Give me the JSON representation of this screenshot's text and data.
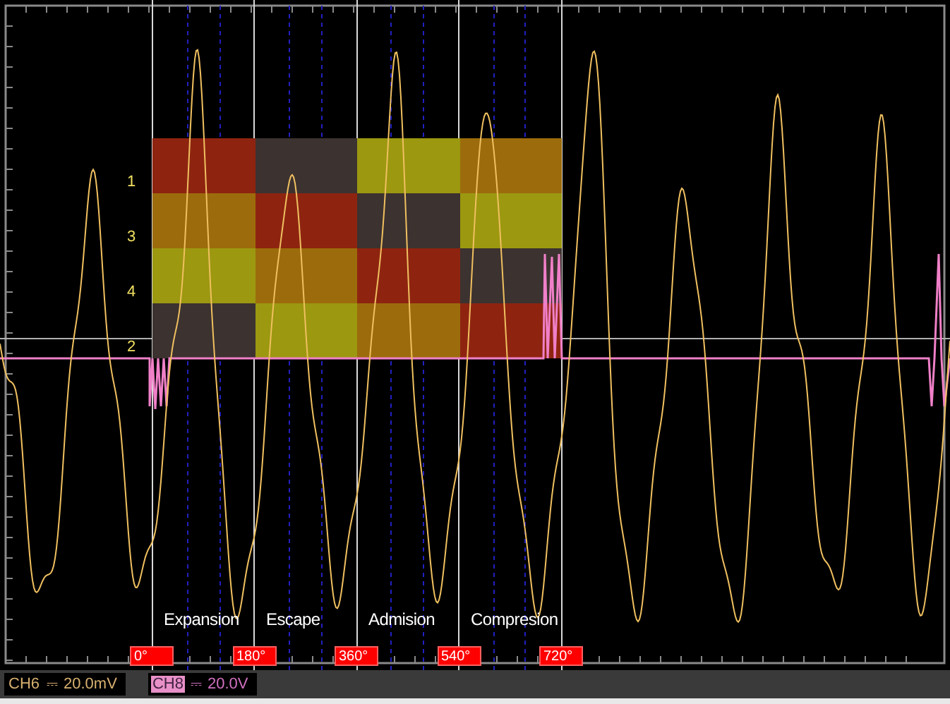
{
  "heatmap": {
    "rows": [
      {
        "label": "1",
        "cells": [
          {
            "color": "#8e2410"
          },
          {
            "color": "#3c3230"
          },
          {
            "color": "#9c9810"
          },
          {
            "color": "#9c6c0c"
          }
        ]
      },
      {
        "label": "3",
        "cells": [
          {
            "color": "#9c6c0c"
          },
          {
            "color": "#8e2410"
          },
          {
            "color": "#3c3230"
          },
          {
            "color": "#9c9810"
          }
        ]
      },
      {
        "label": "4",
        "cells": [
          {
            "color": "#9c9810"
          },
          {
            "color": "#9c6c0c"
          },
          {
            "color": "#8e2410"
          },
          {
            "color": "#3c3230"
          }
        ]
      },
      {
        "label": "2",
        "cells": [
          {
            "color": "#3c3230"
          },
          {
            "color": "#9c9810"
          },
          {
            "color": "#9c6c0c"
          },
          {
            "color": "#8e2410"
          }
        ]
      }
    ]
  },
  "phases": [
    "Expansion",
    "Escape",
    "Admision",
    "Compresion"
  ],
  "markers": [
    "0°",
    "180°",
    "360°",
    "540°",
    "720°"
  ],
  "status_bar": {
    "channels": [
      {
        "name": "CH6",
        "coupling": "⎓",
        "scale": "20.0mV",
        "selected": false
      },
      {
        "name": "CH8",
        "coupling": "⎓",
        "scale": "20.0V",
        "selected": true
      }
    ]
  }
}
